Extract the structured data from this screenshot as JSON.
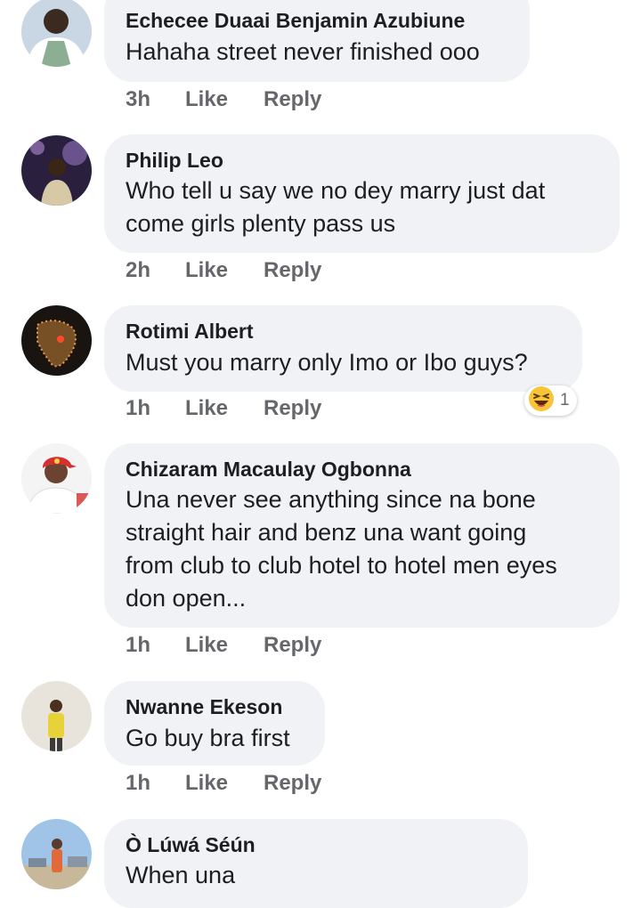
{
  "comments": [
    {
      "author": "Echecee Duaai Benjamin Azubiune",
      "lines": [
        "Hahaha street never finished ooo"
      ],
      "time": "3h",
      "like": "Like",
      "reply": "Reply",
      "avatar_colors": [
        "#c9d6e3",
        "#ffffff",
        "#3a2a1f"
      ]
    },
    {
      "author": "Philip Leo",
      "lines": [
        "Who tell u say we no dey marry just dat",
        "come girls  plenty pass us"
      ],
      "time": "2h",
      "like": "Like",
      "reply": "Reply",
      "avatar_colors": [
        "#2a1f3d",
        "#7a5fa0",
        "#d8c9a6"
      ]
    },
    {
      "author": "Rotimi Albert",
      "lines": [
        "Must you marry only Imo or Ibo guys?"
      ],
      "time": "1h",
      "like": "Like",
      "reply": "Reply",
      "reaction": {
        "icon": "laughing-emoji-icon",
        "count": "1"
      },
      "avatar_colors": [
        "#1a1410",
        "#8a5a2a",
        "#e0a050"
      ]
    },
    {
      "author": "Chizaram Macaulay Ogbonna",
      "lines": [
        "Una never see anything since na bone",
        "straight hair and benz una want going",
        "from club to club hotel to hotel men eyes",
        "don open..."
      ],
      "time": "1h",
      "like": "Like",
      "reply": "Reply",
      "avatar_colors": [
        "#f4f4f4",
        "#d62f2f",
        "#6b4330"
      ]
    },
    {
      "author": "Nwanne Ekeson",
      "lines": [
        "Go buy bra first"
      ],
      "time": "1h",
      "like": "Like",
      "reply": "Reply",
      "avatar_colors": [
        "#e8e4dc",
        "#e8d23a",
        "#4a3020"
      ]
    },
    {
      "author": "Ò Lúwá Séún",
      "lines": [
        "When una"
      ],
      "avatar_colors": [
        "#9fc4e8",
        "#e06a3a",
        "#5a3a28"
      ]
    }
  ]
}
